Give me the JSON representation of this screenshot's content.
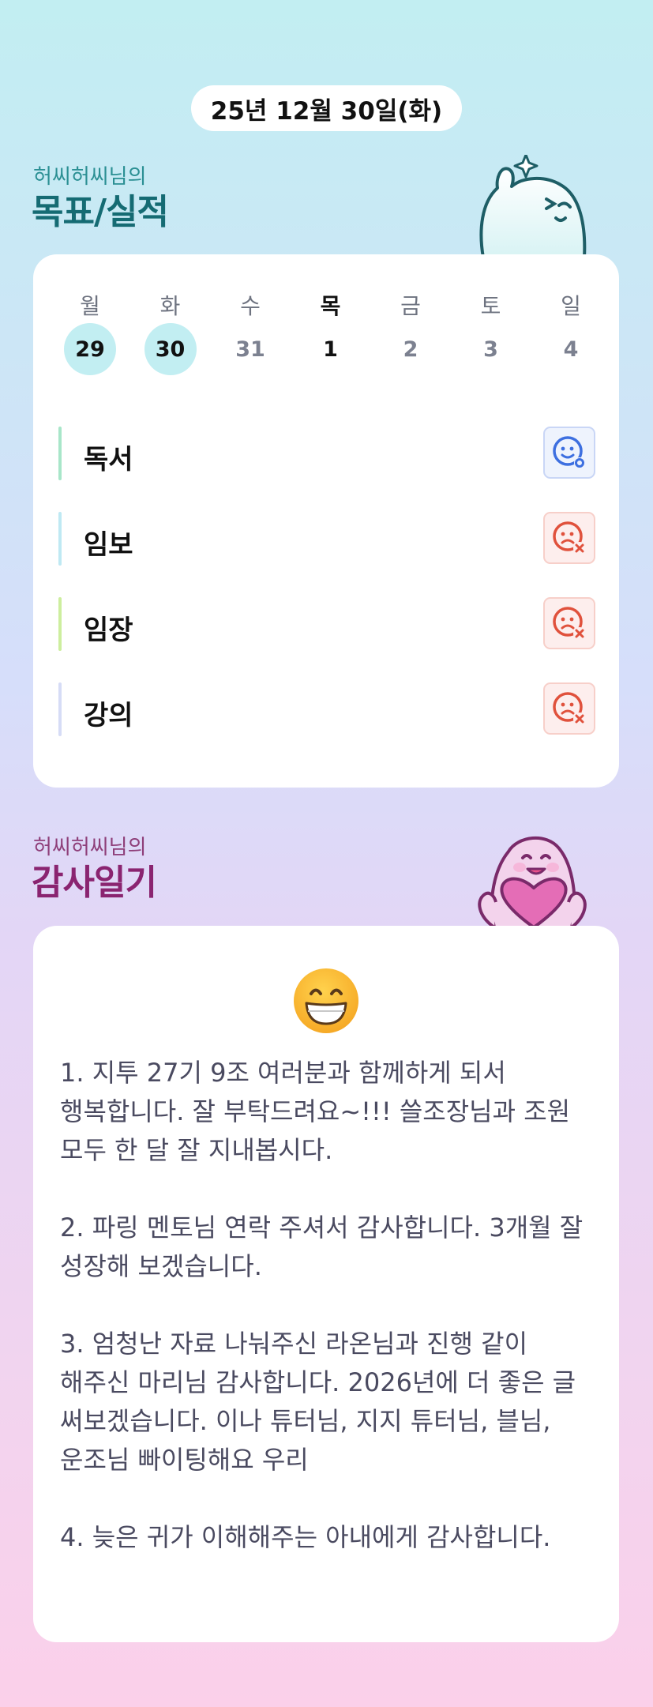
{
  "header": {
    "date": "25년 12월 30일(화)"
  },
  "goals": {
    "subtitle": "허씨허씨님의",
    "title": "목표/실적",
    "week": [
      {
        "dow": "월",
        "day": "29",
        "state": "done"
      },
      {
        "dow": "화",
        "day": "30",
        "state": "done"
      },
      {
        "dow": "수",
        "day": "31",
        "state": "none"
      },
      {
        "dow": "목",
        "day": "1",
        "state": "today"
      },
      {
        "dow": "금",
        "day": "2",
        "state": "none"
      },
      {
        "dow": "토",
        "day": "3",
        "state": "none"
      },
      {
        "dow": "일",
        "day": "4",
        "state": "none"
      }
    ],
    "items": [
      {
        "name": "독서",
        "status": "achieved",
        "bar_color": "#a8e6c9"
      },
      {
        "name": "임보",
        "status": "missed",
        "bar_color": "#bfe9f3"
      },
      {
        "name": "임장",
        "status": "missed",
        "bar_color": "#cdee9e"
      },
      {
        "name": "강의",
        "status": "missed",
        "bar_color": "#d6dcf6"
      }
    ]
  },
  "thanks": {
    "subtitle": "허씨허씨님의",
    "title": "감사일기",
    "mood_icon": "grinning-face",
    "text": "1. 지투 27기 9조 여러분과 함께하게 되서 행복합니다. 잘 부탁드려요~!!! 쓸조장님과 조원 모두 한 달 잘 지내봅시다.\n\n2. 파링 멘토님 연락 주셔서 감사합니다. 3개월 잘 성장해 보겠습니다.\n\n3. 엄청난 자료 나눠주신 라온님과 진행 같이 해주신 마리님 감사합니다. 2026년에 더 좋은 글 써보겠습니다. 이나 튜터님, 지지 튜터님, 블님, 운조님 빠이팅해요 우리\n\n4. 늦은 귀가 이해해주는 아내에게 감사합니다."
  },
  "colors": {
    "achieved": "#3d6fe0",
    "missed": "#e0513c",
    "done_day": "#c2eef2",
    "goals_title": "#156b73",
    "thanks_title": "#8a2470"
  }
}
